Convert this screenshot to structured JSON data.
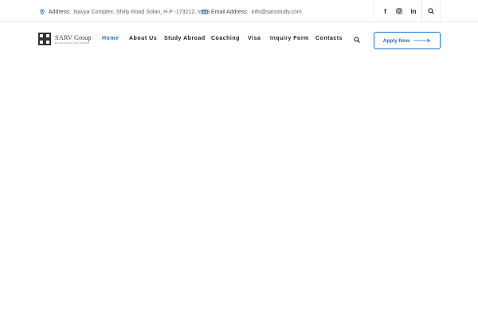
{
  "topbar": {
    "address_label": "Address:",
    "address_value": "Navya Complex, Shilly Road Solan, H.P -173212, India",
    "email_label": "Email Address:",
    "email_value": "info@sarvstudy.com",
    "social": {
      "facebook": "f",
      "linkedin": "in"
    }
  },
  "logo": {
    "name": "SARV Group",
    "tagline": "EXCELLENCE DELIVERED"
  },
  "nav": {
    "items": [
      {
        "label": "Home",
        "active": true
      },
      {
        "label": "About Us",
        "active": false
      },
      {
        "label": "Study Abroad",
        "active": false
      },
      {
        "label": "Coaching",
        "active": false
      },
      {
        "label": "Visa",
        "active": false
      },
      {
        "label": "Inquiry Form",
        "active": false
      },
      {
        "label": "Contacts",
        "active": false
      }
    ],
    "search_icon": "search-icon"
  },
  "cta": {
    "apply_label": "Apply Now"
  },
  "colors": {
    "accent": "#1e73c8",
    "text": "#222222",
    "muted": "#666666",
    "border": "#ececec"
  }
}
